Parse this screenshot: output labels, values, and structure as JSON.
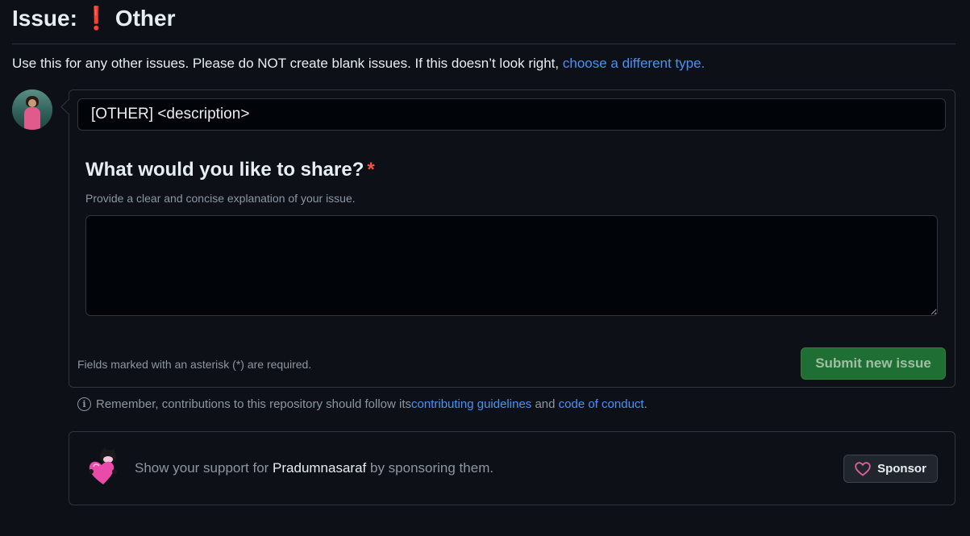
{
  "header": {
    "prefix": "Issue:",
    "emoji": "❗",
    "title": "Other"
  },
  "intro": {
    "text": "Use this for any other issues. Please do NOT create blank issues. If this doesn’t look right, ",
    "link": "choose a different type."
  },
  "form": {
    "title_value": "[OTHER] <description>",
    "question": "What would you like to share?",
    "required_marker": "*",
    "hint": "Provide a clear and concise explanation of your issue.",
    "answer_value": "",
    "required_note": "Fields marked with an asterisk (*) are required.",
    "submit_label": "Submit new issue"
  },
  "notice": {
    "text_before": "Remember, contributions to this repository should follow its ",
    "link1": "contributing guidelines",
    "text_middle": " and ",
    "link2": "code of conduct",
    "text_after": "."
  },
  "sponsor": {
    "text_before": "Show your support for ",
    "name": "Pradumnasaraf",
    "text_after": " by sponsoring them.",
    "button_label": "Sponsor"
  },
  "colors": {
    "background": "#0d1117",
    "link": "#4493f8",
    "submit_bg": "#1f6f34",
    "required": "#f85149",
    "heart": "#db61a2"
  },
  "icons": {
    "avatar": "user-avatar",
    "info": "info-icon",
    "heart": "heart-icon",
    "mona": "mona-heart-icon"
  }
}
